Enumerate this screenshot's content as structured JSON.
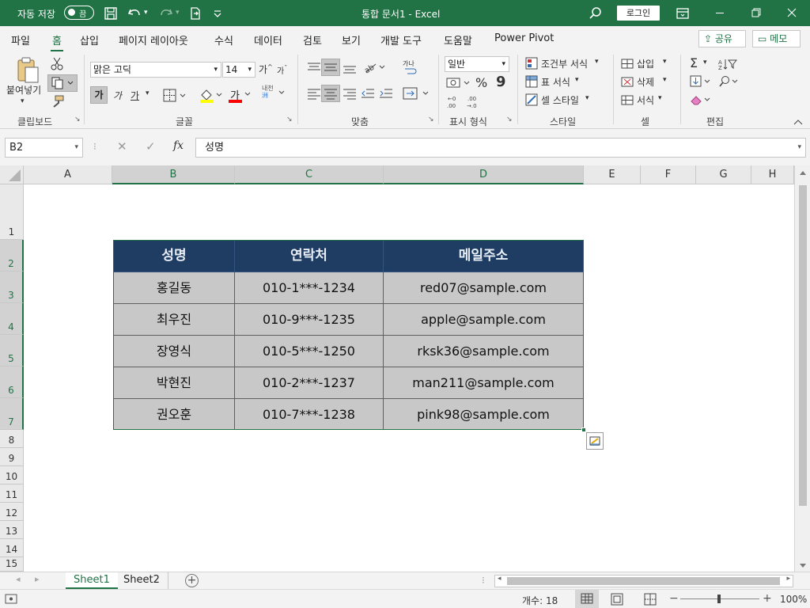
{
  "titlebar": {
    "autosave_label": "자동 저장",
    "autosave_state": "끔",
    "title": "통합 문서1 - Excel",
    "login_label": "로그인"
  },
  "tabs": {
    "items": [
      "파일",
      "홈",
      "삽입",
      "페이지 레이아웃",
      "수식",
      "데이터",
      "검토",
      "보기",
      "개발 도구",
      "도움말",
      "Power Pivot"
    ],
    "share_label": "공유",
    "comment_label": "메모"
  },
  "ribbon": {
    "clipboard": {
      "paste_label": "붙여넣기",
      "group_label": "클립보드"
    },
    "font": {
      "name": "맑은 고딕",
      "size": "14",
      "bold": "가",
      "italic": "가",
      "underline": "가",
      "group_label": "글꼴",
      "grow": "가",
      "shrink": "가",
      "color_glyph": "가",
      "phonetic": "내천"
    },
    "alignment": {
      "group_label": "맞춤",
      "wrap": "가나"
    },
    "number": {
      "format": "일반",
      "group_label": "표시 형식",
      "percent": "%",
      "comma": "9"
    },
    "styles": {
      "conditional": "조건부 서식",
      "table": "표 서식",
      "cell": "셀 스타일",
      "group_label": "스타일"
    },
    "cells": {
      "insert": "삽입",
      "delete": "삭제",
      "format": "서식",
      "group_label": "셀"
    },
    "editing": {
      "group_label": "편집"
    }
  },
  "formula_bar": {
    "name_box": "B2",
    "fx": "fx",
    "content": "성명"
  },
  "columns": [
    "A",
    "B",
    "C",
    "D",
    "E",
    "F",
    "G",
    "H"
  ],
  "rows": [
    "1",
    "2",
    "3",
    "4",
    "5",
    "6",
    "7",
    "8",
    "9",
    "10",
    "11",
    "12",
    "13",
    "14",
    "15"
  ],
  "table": {
    "headers": [
      "성명",
      "연락처",
      "메일주소"
    ],
    "rows": [
      [
        "홍길동",
        "010-1***-1234",
        "red07@sample.com"
      ],
      [
        "최우진",
        "010-9***-1235",
        "apple@sample.com"
      ],
      [
        "장영식",
        "010-5***-1250",
        "rksk36@sample.com"
      ],
      [
        "박현진",
        "010-2***-1237",
        "man211@sample.com"
      ],
      [
        "권오훈",
        "010-7***-1238",
        "pink98@sample.com"
      ]
    ]
  },
  "sheets": [
    "Sheet1",
    "Sheet2"
  ],
  "status": {
    "count": "개수: 18",
    "zoom": "100%"
  },
  "colors": {
    "accent": "#217346",
    "header_fill": "#1f3d63",
    "body_fill": "#c8c8c8"
  }
}
